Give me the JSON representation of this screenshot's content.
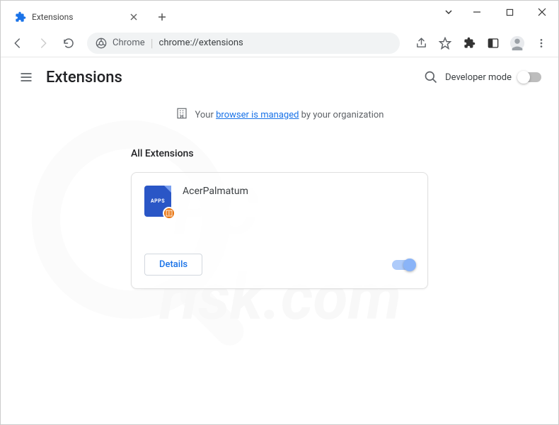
{
  "tab": {
    "title": "Extensions"
  },
  "omnibox": {
    "prefix": "Chrome",
    "url": "chrome://extensions"
  },
  "page": {
    "title": "Extensions",
    "dev_mode_label": "Developer mode",
    "managed_prefix": "Your ",
    "managed_link": "browser is managed",
    "managed_suffix": " by your organization",
    "section_title": "All Extensions"
  },
  "extension": {
    "name": "AcerPalmatum",
    "icon_text": "APPS",
    "details_label": "Details"
  }
}
